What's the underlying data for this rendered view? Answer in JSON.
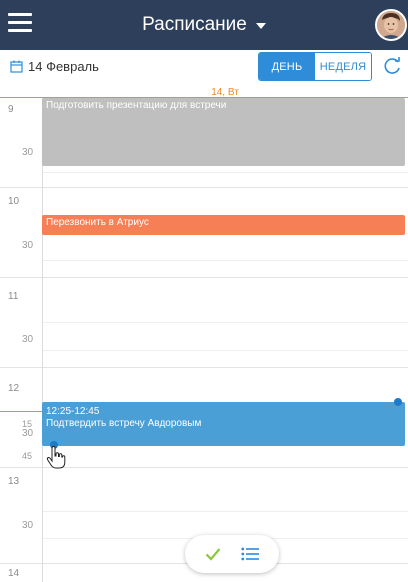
{
  "header": {
    "title": "Расписание"
  },
  "toolbar": {
    "date": "14 Февраль",
    "view_day": "ДЕНЬ",
    "view_week": "НЕДЕЛЯ"
  },
  "calendar": {
    "day_header": "14, Вт",
    "hours": [
      "9",
      "10",
      "11",
      "12",
      "13",
      "14"
    ],
    "half_label": "30",
    "quarter_labels": [
      "15",
      "45"
    ]
  },
  "events": [
    {
      "time": "",
      "title": "Подготовить презентацию для встречи",
      "color": "#bfbfbf"
    },
    {
      "time": "",
      "title": "Перезвонить в Атриус",
      "color": "#f77f55"
    },
    {
      "time": "12:25-12:45",
      "title": "Подтвердить встречу Авдоровым",
      "color": "#4a9fd6"
    }
  ],
  "colors": {
    "header": "#2e3f5b",
    "accent": "#2e8cd8",
    "now": "#f08b2b"
  }
}
